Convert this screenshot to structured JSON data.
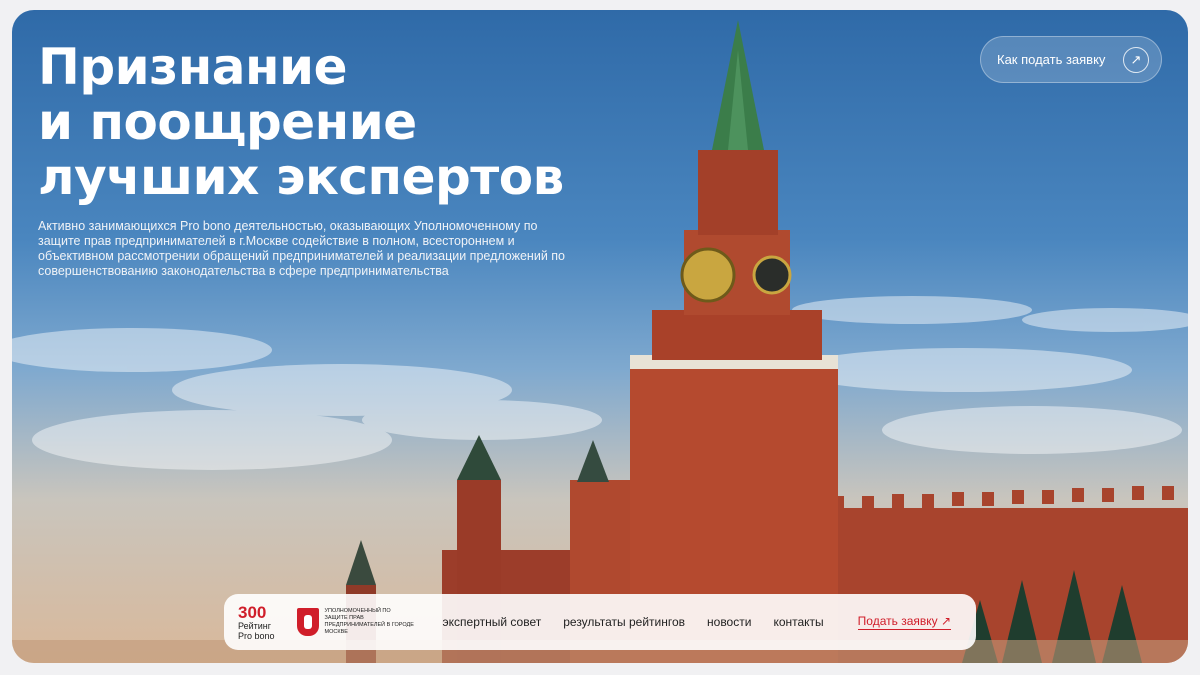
{
  "hero": {
    "title_line1": "Признание",
    "title_line2": "и поощрение",
    "title_line3": "лучших экспертов",
    "description": "Активно занимающихся Pro bono деятельностью, оказывающих Уполномоченному по защите прав предпринимателей в г.Москве содействие в полном, всестороннем и объективном рассмотрении обращений предпринимателей и реализации предложений по совершенствованию законодательства в сфере предпринимательства"
  },
  "top_button": {
    "label": "Как подать заявку",
    "icon": "arrow-up-right-icon"
  },
  "nav": {
    "logo_number": "300",
    "logo_line1": "Рейтинг",
    "logo_line2": "Pro bono",
    "ombudsman_text": "Уполномоченный по защите прав предпринимателей в городе Москве",
    "links": [
      "экспертный совет",
      "результаты рейтингов",
      "новости",
      "контакты"
    ],
    "apply_label": "Подать заявку",
    "accent": "#d01e2a"
  }
}
